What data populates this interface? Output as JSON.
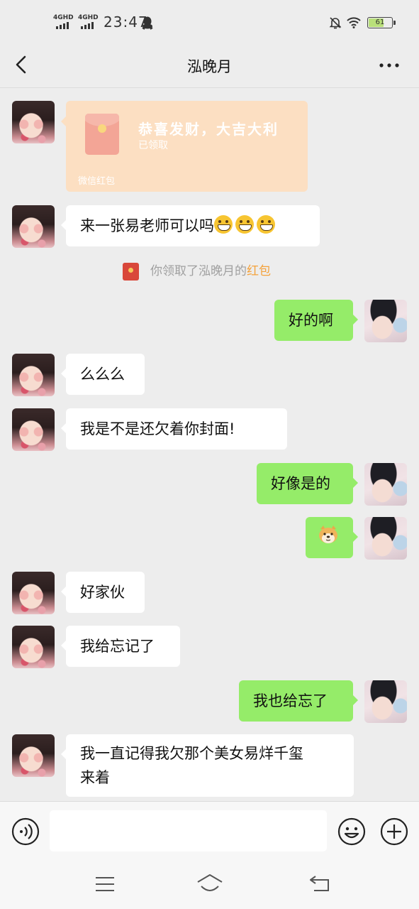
{
  "status_bar": {
    "signal_1": "4GHD",
    "signal_2": "4GHD",
    "time": "23:47",
    "battery_level": "61",
    "icons": [
      "qq-icon",
      "do-not-disturb-icon",
      "wifi-icon",
      "battery-icon"
    ]
  },
  "header": {
    "title": "泓晚月",
    "back_icon": "chevron-left-icon",
    "more_icon": "more-dots-icon"
  },
  "messages": {
    "red_packet": {
      "title": "恭喜发财，大吉大利",
      "status": "已领取",
      "footer": "微信红包"
    },
    "m1": "来一张易老师可以吗",
    "system": {
      "prefix": "你领取了泓晚月的",
      "link": "红包"
    },
    "m2": "好的啊",
    "m3": "么么么",
    "m4": "我是不是还欠着你封面!",
    "m5": "好像是的",
    "m6_sticker": "doge-emoji",
    "m7": "好家伙",
    "m8": "我给忘记了",
    "m9": "我也给忘了",
    "m10_line1": "我一直记得我欠那个美女易烊千玺",
    "m10_line2": "来着"
  },
  "input_bar": {
    "value": "",
    "voice_icon": "voice-icon",
    "emoji_icon": "emoji-icon",
    "plus_icon": "plus-icon"
  },
  "system_nav": [
    "menu-icon",
    "home-icon",
    "back-icon"
  ],
  "colors": {
    "background": "#ededed",
    "outgoing_bubble": "#95ec69",
    "incoming_bubble": "#ffffff",
    "red_packet_opened": "#fcdfc2",
    "link_orange": "#f4a23b"
  }
}
